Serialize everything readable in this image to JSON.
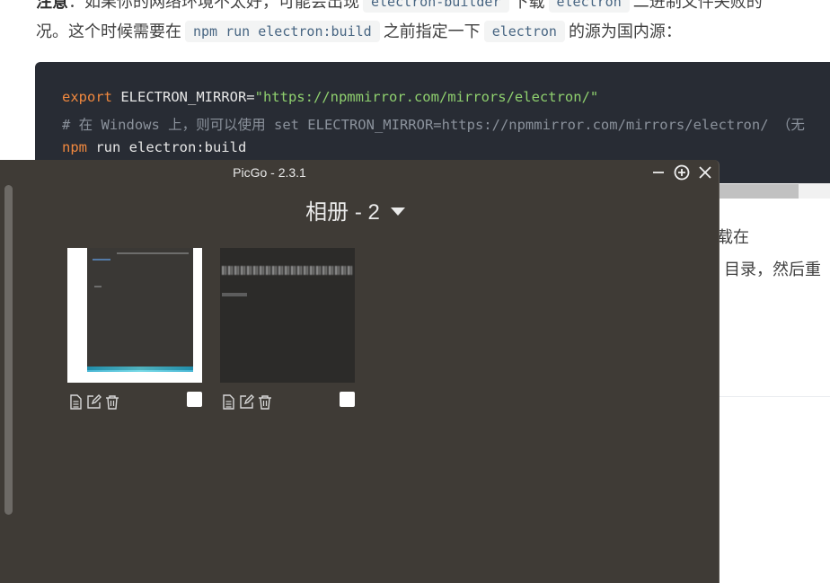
{
  "article": {
    "para1": {
      "bold": "注意",
      "t1": "：如果你的网络环境不太好，可能会出现",
      "c1": "electron-builder",
      "t2": "下载",
      "c2": "electron",
      "t3": "二进制文件失败的"
    },
    "para2": {
      "t1": "况。这个时候需要在",
      "c1": "npm run electron:build",
      "t2": "之前指定一下",
      "c2": "electron",
      "t3": "的源为国内源："
    },
    "code": {
      "line1": {
        "kw": "export",
        "rest": " ELECTRON_MIRROR=",
        "str": "\"https://npmmirror.com/mirrors/electron/\""
      },
      "line2": "# 在 Windows 上，则可以使用 set ELECTRON_MIRROR=https://npmmirror.com/mirrors/electron/ （无",
      "line3": {
        "kw": "npm",
        "rest": " run electron:build"
      }
    },
    "para3": "载在",
    "para4": "目录，然后重"
  },
  "picgo": {
    "title": "PicGo - 2.3.1",
    "album_title": "相册 - 2",
    "images": [
      {
        "selected": false
      },
      {
        "selected": false
      }
    ]
  },
  "colors": {
    "window_bg": "#3f3b36",
    "code_bg": "#282c34",
    "keyword": "#f0883e",
    "string": "#8fd06e"
  },
  "icons": {
    "minimize": "minimize-icon",
    "pin": "pin-icon",
    "close": "close-icon",
    "dropdown": "caret-down-icon",
    "copy": "document-icon",
    "edit": "edit-icon",
    "delete": "trash-icon"
  }
}
